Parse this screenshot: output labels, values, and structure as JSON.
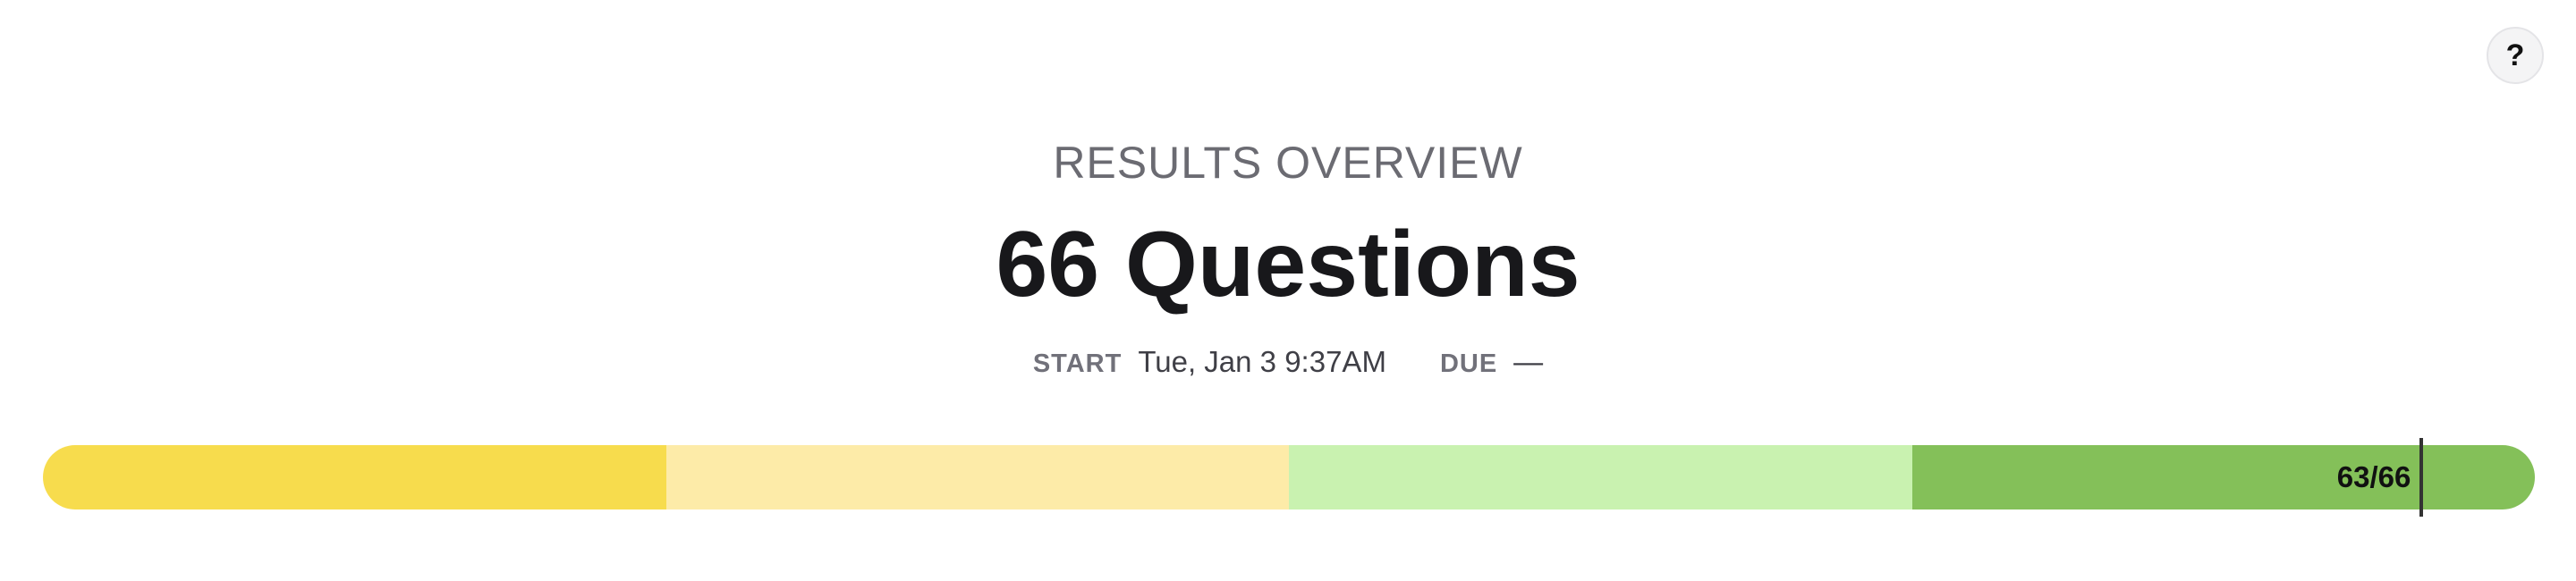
{
  "header": {
    "help_label": "?"
  },
  "overview": {
    "label": "RESULTS OVERVIEW",
    "title": "66 Questions"
  },
  "meta": {
    "start_key": "START",
    "start_value": "Tue, Jan 3 9:37AM",
    "due_key": "DUE",
    "due_value": "—"
  },
  "progress": {
    "label": "63/66",
    "completed": 63,
    "total": 66,
    "segments": [
      {
        "fraction": 0.25,
        "color": "#f7dc4d"
      },
      {
        "fraction": 0.25,
        "color": "#fdeba8"
      },
      {
        "fraction": 0.25,
        "color": "#c9f2b0"
      },
      {
        "fraction": 0.25,
        "color": "#84c059"
      }
    ]
  }
}
